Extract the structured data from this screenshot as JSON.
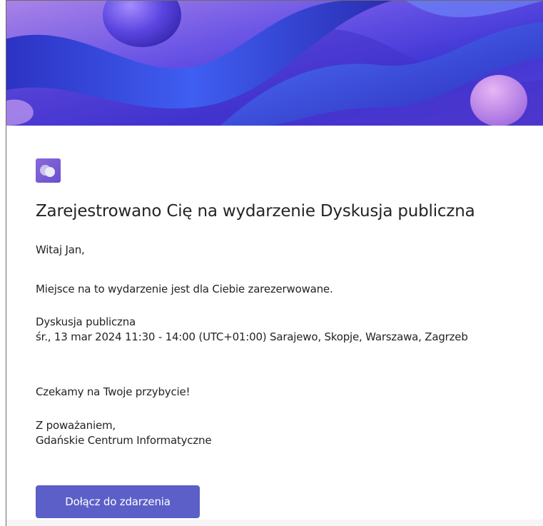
{
  "email": {
    "title": "Zarejestrowano Cię na wydarzenie Dyskusja publiczna",
    "greeting": "Witaj Jan,",
    "reserved_text": "Miejsce na to wydarzenie jest dla Ciebie zarezerwowane.",
    "event_name": "Dyskusja publiczna",
    "event_datetime": "śr., 13 mar 2024 11:30 - 14:00 (UTC+01:00) Sarajewo, Skopje, Warszawa, Zagrzeb",
    "waiting_text": "Czekamy na Twoje przybycie!",
    "closing": "Z poważaniem,",
    "organizer": "Gdańskie Centrum Informatyczne",
    "join_button_label": "Dołącz do zdarzenia"
  },
  "icons": {
    "app_icon": "chat-bubbles-icon"
  },
  "colors": {
    "accent": "#5b5fc7",
    "text": "#242424",
    "banner_primary": "#3a3fd8",
    "banner_secondary": "#b08ae8"
  }
}
